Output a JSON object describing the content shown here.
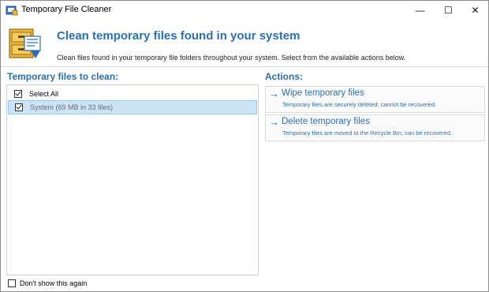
{
  "window": {
    "title": "Temporary File Cleaner",
    "controls": {
      "minimize": "—",
      "maximize": "☐",
      "close": "✕"
    }
  },
  "header": {
    "title": "Clean temporary files found in your system",
    "description": "Clean files found in your temporary file folders throughout your system. Select from the available actions below."
  },
  "files_panel": {
    "label": "Temporary files to clean:",
    "items": [
      {
        "label": "Select All",
        "checked": true
      },
      {
        "label": "System (69 MB in 33 files)",
        "checked": true
      }
    ]
  },
  "actions_panel": {
    "label": "Actions:",
    "arrow": "→",
    "items": [
      {
        "title": "Wipe temporary files",
        "subtitle": "Temporary files are securely deleted; cannot be recovered."
      },
      {
        "title": "Delete temporary files",
        "subtitle": "Temporary files are moved to the Recycle Bin; can be recovered."
      }
    ]
  },
  "footer": {
    "dont_show_label": "Don't show this again",
    "checked": false
  },
  "colors": {
    "accent": "#2a6fb5",
    "selection": "#cce4f7"
  }
}
